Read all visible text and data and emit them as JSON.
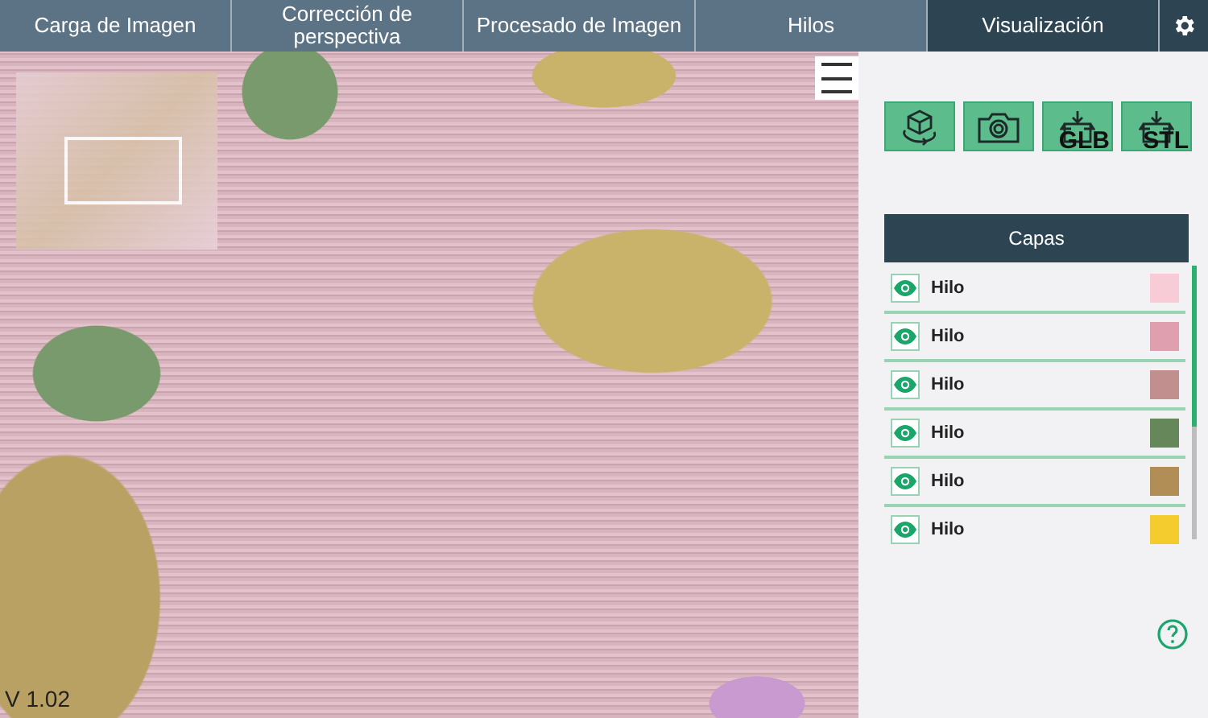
{
  "tabs": [
    {
      "label": "Carga de Imagen",
      "selected": false
    },
    {
      "label": "Corrección de perspectiva",
      "selected": false
    },
    {
      "label": "Procesado de Imagen",
      "selected": false
    },
    {
      "label": "Hilos",
      "selected": false
    },
    {
      "label": "Visualización",
      "selected": true
    }
  ],
  "viewer": {
    "version": "V 1.02"
  },
  "toolbar": [
    {
      "kind": "rotate"
    },
    {
      "kind": "camera"
    },
    {
      "kind": "export",
      "label": "GLB"
    },
    {
      "kind": "export",
      "label": "STL"
    }
  ],
  "layers": {
    "title": "Capas",
    "items": [
      {
        "name": "Hilo",
        "visible": true,
        "color": "#f8ccd6"
      },
      {
        "name": "Hilo",
        "visible": true,
        "color": "#e09fae"
      },
      {
        "name": "Hilo",
        "visible": true,
        "color": "#c28f8f"
      },
      {
        "name": "Hilo",
        "visible": true,
        "color": "#66875a"
      },
      {
        "name": "Hilo",
        "visible": true,
        "color": "#b08e55"
      },
      {
        "name": "Hilo",
        "visible": true,
        "color": "#f5cc2e"
      }
    ]
  }
}
